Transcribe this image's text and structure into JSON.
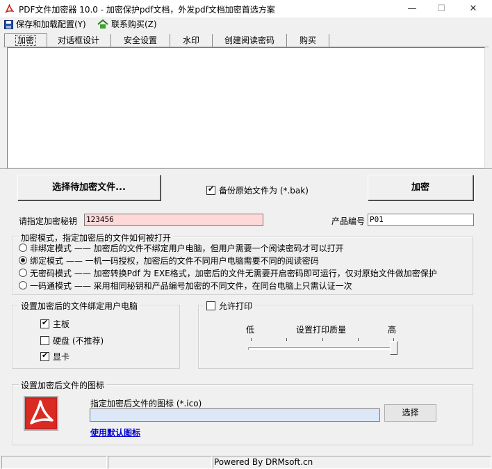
{
  "window": {
    "title": "PDF文件加密器 10.0 - 加密保护pdf文档，外发pdf文档加密首选方案",
    "minimize": "—",
    "maximize": "☐",
    "close": "✕"
  },
  "menu": {
    "save_config": "保存和加载配置(Y)",
    "contact_buy": "联系购买(Z)"
  },
  "tabs": [
    "加密",
    "对话框设计",
    "安全设置",
    "水印",
    "创建阅读密码",
    "购买"
  ],
  "actions": {
    "select_files": "选择待加密文件...",
    "backup_label": "备份原始文件为 (*.bak)",
    "backup_checked": true,
    "encrypt": "加密"
  },
  "key": {
    "label": "请指定加密秘钥",
    "value": "123456",
    "product_label": "产品编号",
    "product_value": "P01"
  },
  "mode": {
    "legend": "加密模式，指定加密后的文件如何被打开",
    "options": [
      {
        "name": "非绑定模式",
        "dash": "——",
        "desc": "加密后的文件不绑定用户电脑，但用户需要一个阅读密码才可以打开",
        "checked": false
      },
      {
        "name": "绑定模式",
        "dash": "——",
        "desc": "一机一码授权，加密后的文件不同用户电脑需要不同的阅读密码",
        "checked": true
      },
      {
        "name": "无密码模式",
        "dash": "——",
        "desc": "加密转换Pdf 为 EXE格式，加密后的文件无需要开启密码即可运行，仅对原始文件做加密保护",
        "checked": false
      },
      {
        "name": "一码通模式",
        "dash": "——",
        "desc": "采用相同秘钥和产品编号加密的不同文件，在同台电脑上只需认证一次",
        "checked": false
      }
    ]
  },
  "binding": {
    "legend": "设置加密后的文件绑定用户电脑",
    "items": [
      {
        "label": "主板",
        "checked": true
      },
      {
        "label": "硬盘 (不推荐)",
        "checked": false
      },
      {
        "label": "显卡",
        "checked": true
      }
    ]
  },
  "print": {
    "legend": "允许打印",
    "checked": false,
    "low": "低",
    "quality": "设置打印质量",
    "high": "高",
    "level_fraction": 1.0
  },
  "icon": {
    "legend": "设置加密后文件的图标",
    "prompt": "指定加密后文件的图标 (*.ico)",
    "path": "",
    "choose": "选择",
    "use_default": "使用默认图标"
  },
  "status": {
    "powered": "Powered By DRMsoft.cn"
  },
  "colors": {
    "key_field_bg": "#ffd8d8",
    "icon_path_bg": "#dce8f8",
    "acrobat_red": "#c8201e"
  }
}
